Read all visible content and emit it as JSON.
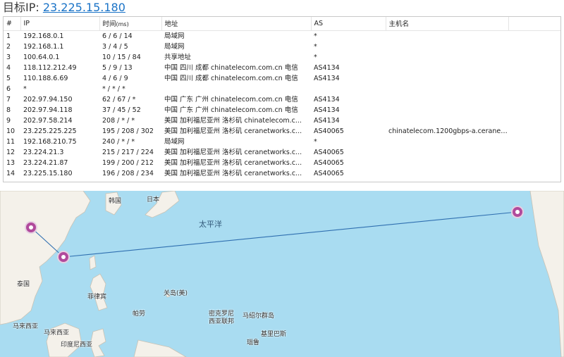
{
  "header": {
    "label": "目标IP:",
    "ip": "23.225.15.180"
  },
  "table": {
    "columns": [
      "#",
      "IP",
      "时间",
      "(ms)",
      "地址",
      "AS",
      "主机名"
    ],
    "rows": [
      {
        "n": "1",
        "ip": "192.168.0.1",
        "time": "6 / 6 / 14",
        "addr": "局域网",
        "as": "*",
        "host": ""
      },
      {
        "n": "2",
        "ip": "192.168.1.1",
        "time": "3 / 4 / 5",
        "addr": "局域网",
        "as": "*",
        "host": ""
      },
      {
        "n": "3",
        "ip": "100.64.0.1",
        "time": "10 / 15 / 84",
        "addr": "共享地址",
        "as": "*",
        "host": ""
      },
      {
        "n": "4",
        "ip": "118.112.212.49",
        "time": "5 / 9 / 13",
        "addr": "中国 四川 成都 chinatelecom.com.cn 电信",
        "as": "AS4134",
        "host": ""
      },
      {
        "n": "5",
        "ip": "110.188.6.69",
        "time": "4 / 6 / 9",
        "addr": "中国 四川 成都 chinatelecom.com.cn 电信",
        "as": "AS4134",
        "host": ""
      },
      {
        "n": "6",
        "ip": "*",
        "time": "* / * / *",
        "addr": "",
        "as": "",
        "host": ""
      },
      {
        "n": "7",
        "ip": "202.97.94.150",
        "time": "62 / 67 / *",
        "addr": "中国 广东 广州 chinatelecom.com.cn 电信",
        "as": "AS4134",
        "host": ""
      },
      {
        "n": "8",
        "ip": "202.97.94.118",
        "time": "37 / 45 / 52",
        "addr": "中国 广东 广州 chinatelecom.com.cn 电信",
        "as": "AS4134",
        "host": ""
      },
      {
        "n": "9",
        "ip": "202.97.58.214",
        "time": "208 / * / *",
        "addr": "美国 加利福尼亚州 洛杉矶 chinatelecom.c...",
        "as": "AS4134",
        "host": ""
      },
      {
        "n": "10",
        "ip": "23.225.225.225",
        "time": "195 / 208 / 302",
        "addr": "美国 加利福尼亚州 洛杉矶 ceranetworks.c...",
        "as": "AS40065",
        "host": "chinatelecom.1200gbps-a.ceranetw..."
      },
      {
        "n": "11",
        "ip": "192.168.210.75",
        "time": "240 / * / *",
        "addr": "局域网",
        "as": "*",
        "host": ""
      },
      {
        "n": "12",
        "ip": "23.224.21.3",
        "time": "215 / 217 / 224",
        "addr": "美国 加利福尼亚州 洛杉矶 ceranetworks.c...",
        "as": "AS40065",
        "host": ""
      },
      {
        "n": "13",
        "ip": "23.224.21.87",
        "time": "199 / 200 / 212",
        "addr": "美国 加利福尼亚州 洛杉矶 ceranetworks.c...",
        "as": "AS40065",
        "host": ""
      },
      {
        "n": "14",
        "ip": "23.225.15.180",
        "time": "196 / 208 / 234",
        "addr": "美国 加利福尼亚州 洛杉矶 ceranetworks.c...",
        "as": "AS40065",
        "host": ""
      }
    ]
  },
  "map": {
    "ocean_label": "太平洋",
    "places": [
      "韩国",
      "日本",
      "泰国",
      "菲律宾",
      "关岛(美)",
      "帕劳",
      "密克罗尼",
      "西亚联邦",
      "马绍尔群岛",
      "马来西亚",
      "马来西亚",
      "基里巴斯",
      "瑙鲁",
      "印度尼西亚"
    ],
    "colors": {
      "ocean": "#a9dcf1",
      "land": "#f4f1ea",
      "route": "#2f6fb0",
      "marker": "#b14a9c"
    }
  }
}
